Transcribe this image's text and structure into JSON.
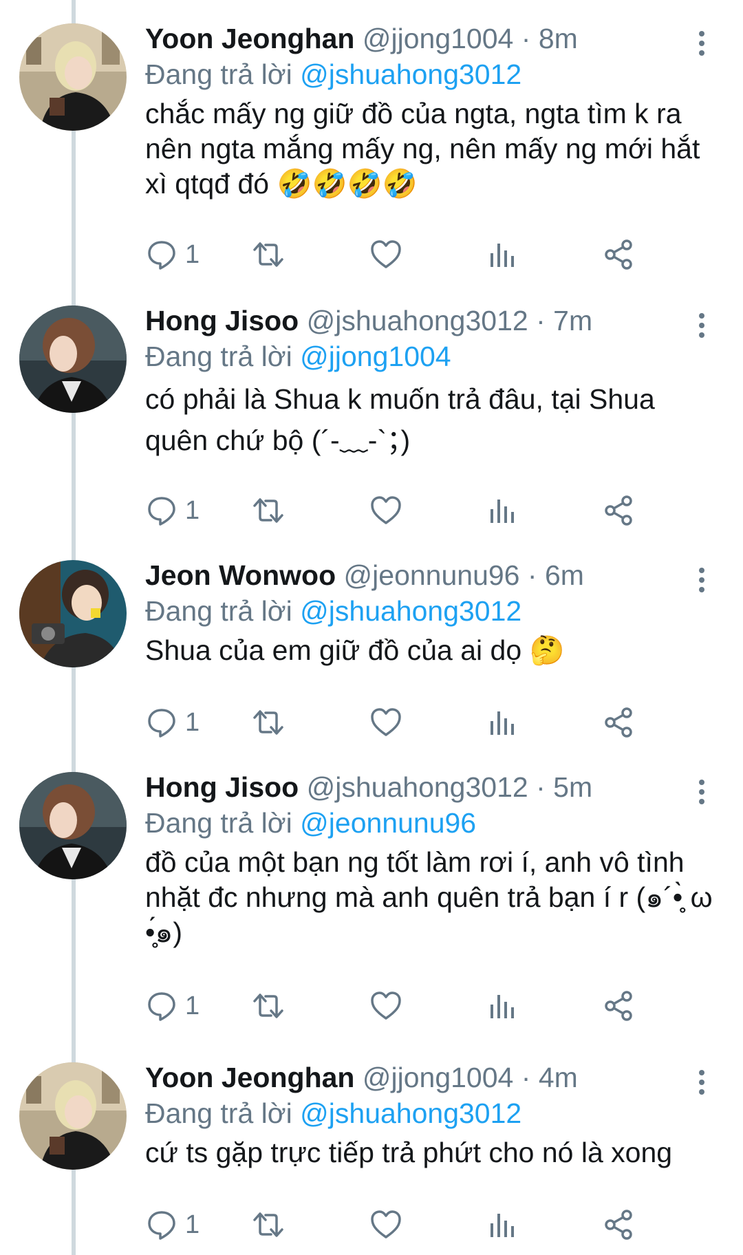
{
  "tweets": [
    {
      "name": "Yoon Jeonghan",
      "handle": "@jjong1004",
      "separator": "·",
      "time": "8m",
      "replying_label": "Đang trả lời",
      "replying_to": "@jshuahong3012",
      "text": "chắc mấy ng giữ đồ của ngta, ngta tìm k ra nên ngta mắng mấy ng, nên mấy ng mới hắt xì qtqđ đó 🤣🤣🤣🤣",
      "reply_count": "1",
      "avatar": "blonde-person-avatar"
    },
    {
      "name": "Hong Jisoo",
      "handle": "@jshuahong3012",
      "separator": "·",
      "time": "7m",
      "replying_label": "Đang trả lời",
      "replying_to": "@jjong1004",
      "text": "có phải là Shua k muốn trả đâu, tại Shua quên chứ bộ (´-﹏-`；)",
      "reply_count": "1",
      "avatar": "brown-hair-person-avatar"
    },
    {
      "name": "Jeon Wonwoo",
      "handle": "@jeonnunu96",
      "separator": "·",
      "time": "6m",
      "replying_label": "Đang trả lời",
      "replying_to": "@jshuahong3012",
      "text": "Shua của em giữ đồ của ai dọ 🤔",
      "reply_count": "1",
      "avatar": "camera-person-avatar"
    },
    {
      "name": "Hong Jisoo",
      "handle": "@jshuahong3012",
      "separator": "·",
      "time": "5m",
      "replying_label": "Đang trả lời",
      "replying_to": "@jeonnunu96",
      "text": "đồ của một bạn ng tốt làm rơi í, anh vô tình nhặt đc nhưng mà anh quên trả bạn í r (๑´•̥̥̀ ω •̥̥́๑)",
      "reply_count": "1",
      "avatar": "brown-hair-person-avatar"
    },
    {
      "name": "Yoon Jeonghan",
      "handle": "@jjong1004",
      "separator": "·",
      "time": "4m",
      "replying_label": "Đang trả lời",
      "replying_to": "@jshuahong3012",
      "text": "cứ ts gặp trực tiếp trả phứt cho nó là xong",
      "reply_count": "1",
      "avatar": "blonde-person-avatar"
    }
  ],
  "colors": {
    "link": "#1da1f2",
    "secondary": "#657786",
    "thread_line": "#cfd9de"
  },
  "icons": [
    "reply-icon",
    "retweet-icon",
    "like-icon",
    "analytics-icon",
    "share-icon",
    "more-icon"
  ]
}
